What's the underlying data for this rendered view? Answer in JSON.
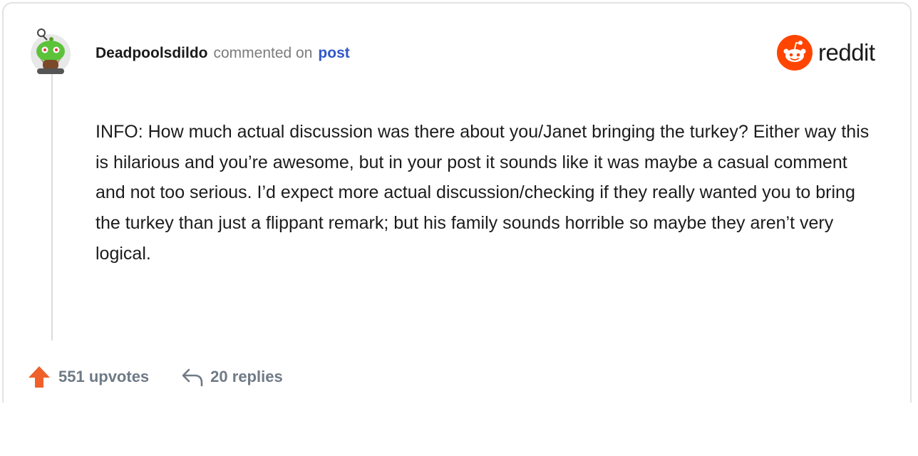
{
  "comment": {
    "username": "Deadpoolsdildo",
    "action": "commented on",
    "post_link": "post",
    "body": "INFO: How much actual discussion was there about you/Janet bringing the turkey? Either way this is hilarious and you’re awesome, but in your post it sounds like it was maybe a casual comment and not too serious. I’d expect more actual discussion/checking if they really wanted you to bring the turkey than just a flippant remark; but his family sounds horrible so maybe they aren’t very logical.",
    "upvotes_label": "551 upvotes",
    "replies_label": "20 replies"
  },
  "brand": {
    "name": "reddit",
    "accent_color": "#ff4500"
  },
  "icons": {
    "avatar": "snoo-avatar",
    "logo": "reddit-snoo-icon",
    "upvote": "upvote-arrow-icon",
    "reply": "reply-arrow-icon"
  },
  "colors": {
    "username": "#1a1a1b",
    "link": "#2f57c9",
    "muted": "#7c7c7c",
    "footer": "#6f7a86",
    "upvote": "#f0602b"
  }
}
